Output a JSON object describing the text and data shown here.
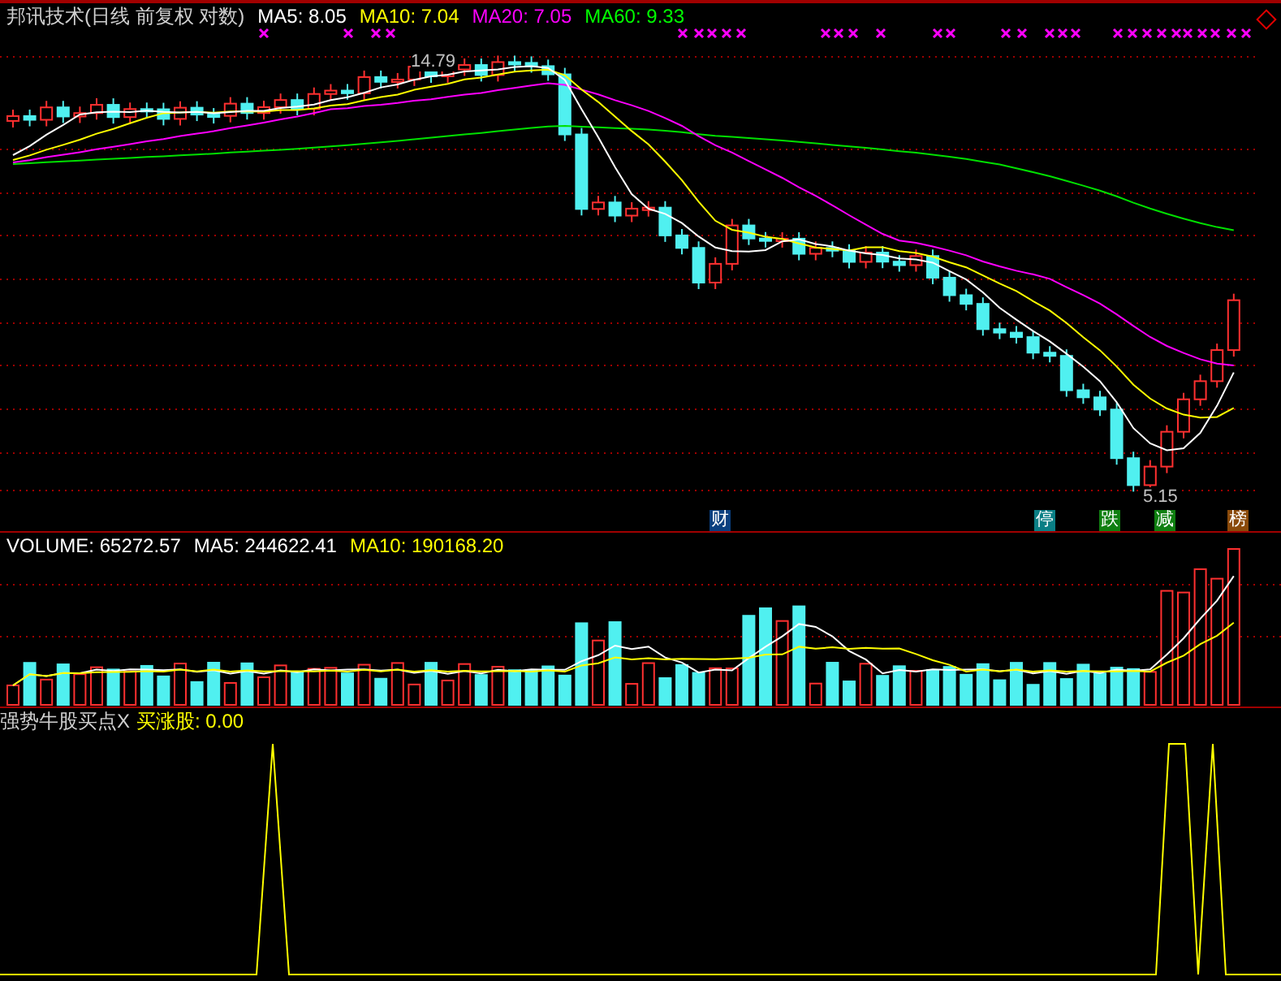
{
  "price_panel": {
    "title": "邦讯技术(日线 前复权 对数)",
    "moving_averages": [
      {
        "label": "MA5: 8.05",
        "color": "#ffffff"
      },
      {
        "label": "MA10: 7.04",
        "color": "#ffff00"
      },
      {
        "label": "MA20: 7.05",
        "color": "#ff00ff"
      },
      {
        "label": "MA60: 9.33",
        "color": "#00ff00"
      }
    ],
    "price_labels": [
      "14.79",
      "5.15"
    ],
    "badges": [
      {
        "text": "财",
        "color": "#0a3f7f"
      },
      {
        "text": "停",
        "color": "#0a7f85"
      },
      {
        "text": "跌",
        "color": "#0f7f10"
      },
      {
        "text": "减",
        "color": "#0f7f10"
      },
      {
        "text": "榜",
        "color": "#8a4a0a"
      }
    ]
  },
  "volume_panel": {
    "items": [
      {
        "label": "VOLUME: 65272.57",
        "color": "#ffffff"
      },
      {
        "label": "MA5: 244622.41",
        "color": "#ffffff"
      },
      {
        "label": "MA10: 190168.20",
        "color": "#ffff00"
      }
    ]
  },
  "indicator_panel": {
    "name": "强势牛股买点X",
    "value": "买涨股: 0.00"
  }
}
